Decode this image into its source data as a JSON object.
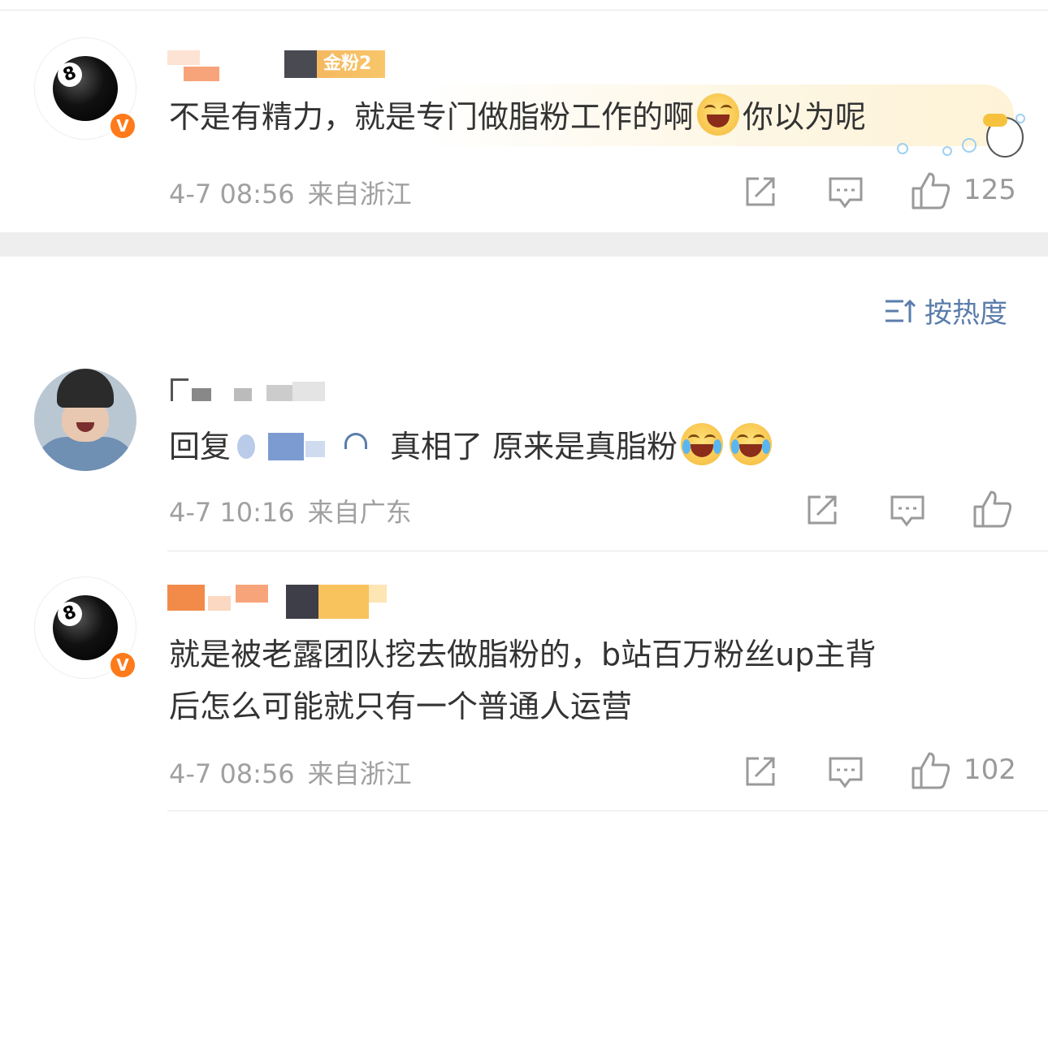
{
  "comments": [
    {
      "text": "不是有精力，就是专门做脂粉工作的啊",
      "text_tail": "你以为呢",
      "badge": "金粉2",
      "time": "4-7 08:56",
      "region": "来自浙江",
      "likes": "125"
    },
    {
      "reply_prefix": "回复",
      "text": "真相了 原来是真脂粉",
      "time": "4-7 10:16",
      "region": "来自广东",
      "likes": ""
    },
    {
      "text_line1": "就是被老露团队挖去做脂粉的，b站百万粉丝up主背",
      "text_line2": "后怎么可能就只有一个普通人运营",
      "time": "4-7 08:56",
      "region": "来自浙江",
      "likes": "102"
    }
  ],
  "sort": {
    "label": "按热度"
  },
  "icons": {
    "share": "share-icon",
    "comment": "comment-icon",
    "like": "thumbs-up-icon",
    "sort": "sort-icon",
    "verified": "verified-v-icon"
  },
  "colors": {
    "accent": "#ff7a1a",
    "link": "#5a7dab",
    "meta": "#a0a0a0",
    "text": "#333333"
  }
}
